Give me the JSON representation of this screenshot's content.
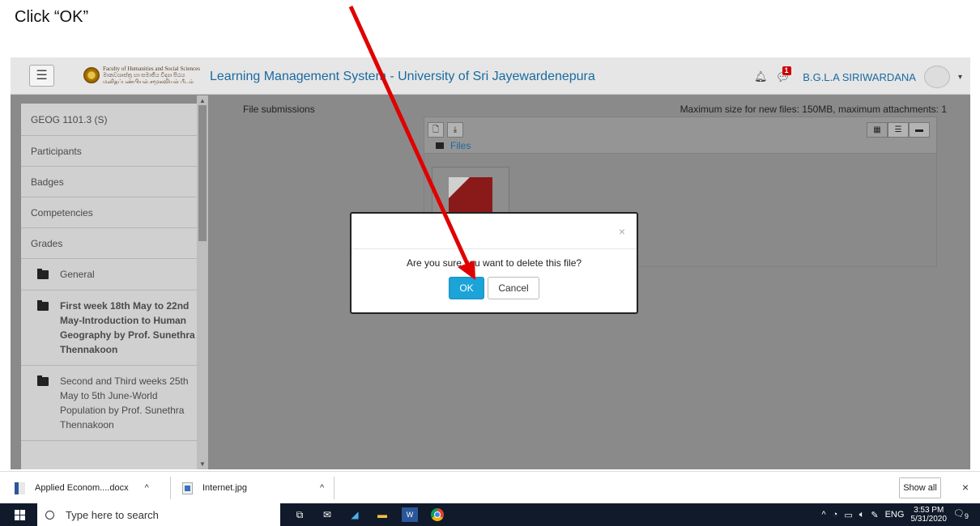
{
  "instruction": "Click “OK”",
  "navbar": {
    "menu_icon": "☰",
    "logo_line1": "Faculty of Humanities and Social Sciences",
    "logo_line2": "මානවශාස්ත්‍ර හා සමාජීය විද්‍යා පීඨය",
    "logo_line3": "மனிதப்பண்பியல் சமூகவியல் பீடம்",
    "site_title": "Learning Management System - University of Sri Jayewardenepura",
    "bell_icon": "bell-icon",
    "message_badge": "1",
    "user_name": "B.G.L.A SIRIWARDANA",
    "caret": "▾"
  },
  "sidebar": {
    "items": [
      {
        "label": "GEOG 1101.3 (S)"
      },
      {
        "label": "Participants"
      },
      {
        "label": "Badges"
      },
      {
        "label": "Competencies"
      },
      {
        "label": "Grades"
      }
    ],
    "sections": [
      {
        "label": "General"
      },
      {
        "label": "First week 18th May to 22nd May-Introduction to Human Geography by Prof. Sunethra Thennakoon"
      },
      {
        "label": "Second and Third weeks 25th May to 5th June-World Population by Prof. Sunethra Thennakoon"
      }
    ]
  },
  "content": {
    "file_submissions_label": "File submissions",
    "max_size_text": "Maximum size for new files: 150MB, maximum attachments: 1",
    "breadcrumb_files": "Files",
    "view_icons": [
      "grid-view-icon",
      "list-view-icon",
      "folder-view-icon"
    ]
  },
  "modal": {
    "close": "×",
    "message": "Are you sure you want to delete this file?",
    "ok_label": "OK",
    "cancel_label": "Cancel"
  },
  "downloads": {
    "items": [
      {
        "name": "Applied Econom....docx"
      },
      {
        "name": "Internet.jpg"
      }
    ],
    "show_all": "Show all",
    "close": "×"
  },
  "taskbar": {
    "search_placeholder": "Type here to search",
    "lang": "ENG",
    "time": "3:53 PM",
    "date": "5/31/2020",
    "notification_count": "9"
  },
  "colors": {
    "ok_button": "#1ca3d8",
    "link_blue": "#1a6aa0",
    "arrow_red": "#e00000"
  }
}
